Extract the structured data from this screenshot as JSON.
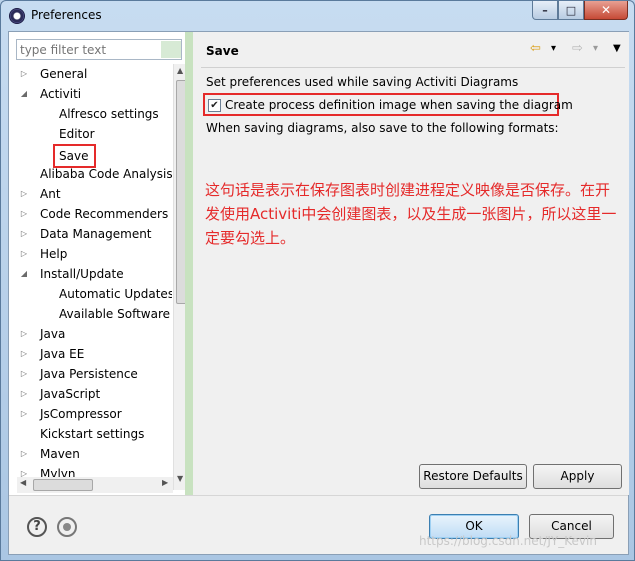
{
  "window": {
    "title": "Preferences",
    "min": "–",
    "max": "□",
    "close": "✕"
  },
  "filter": {
    "placeholder": "type filter text"
  },
  "tree": [
    {
      "label": "General",
      "level": 0,
      "twisty": "▷"
    },
    {
      "label": "Activiti",
      "level": 0,
      "twisty": "◢"
    },
    {
      "label": "Alfresco settings",
      "level": 1,
      "twisty": ""
    },
    {
      "label": "Editor",
      "level": 1,
      "twisty": ""
    },
    {
      "label": "Save",
      "level": 1,
      "twisty": "",
      "selected": true
    },
    {
      "label": "Alibaba Code Analysis",
      "level": 0,
      "twisty": ""
    },
    {
      "label": "Ant",
      "level": 0,
      "twisty": "▷"
    },
    {
      "label": "Code Recommenders",
      "level": 0,
      "twisty": "▷"
    },
    {
      "label": "Data Management",
      "level": 0,
      "twisty": "▷"
    },
    {
      "label": "Help",
      "level": 0,
      "twisty": "▷"
    },
    {
      "label": "Install/Update",
      "level": 0,
      "twisty": "◢"
    },
    {
      "label": "Automatic Updates",
      "level": 1,
      "twisty": ""
    },
    {
      "label": "Available Software",
      "level": 1,
      "twisty": ""
    },
    {
      "label": "Java",
      "level": 0,
      "twisty": "▷"
    },
    {
      "label": "Java EE",
      "level": 0,
      "twisty": "▷"
    },
    {
      "label": "Java Persistence",
      "level": 0,
      "twisty": "▷"
    },
    {
      "label": "JavaScript",
      "level": 0,
      "twisty": "▷"
    },
    {
      "label": "JsCompressor",
      "level": 0,
      "twisty": "▷"
    },
    {
      "label": "Kickstart settings",
      "level": 0,
      "twisty": ""
    },
    {
      "label": "Maven",
      "level": 0,
      "twisty": "▷"
    },
    {
      "label": "Mylyn",
      "level": 0,
      "twisty": "▷"
    }
  ],
  "page": {
    "title": "Save",
    "description": "Set preferences used while saving Activiti Diagrams",
    "checkbox_label": "Create process definition image when saving the diagram",
    "checkbox_checked": true,
    "checkbox_mark": "✔",
    "formats_label": "When saving diagrams, also save to the following formats:",
    "annotation": "这句话是表示在保存图表时创建进程定义映像是否保存。在开发使用Activiti中会创建图表，以及生成一张图片，所以这里一定要勾选上。",
    "nav_back": "⇦",
    "nav_forward": "⇨",
    "nav_dropdown": "▾",
    "nav_menu": "▼"
  },
  "buttons": {
    "restore_defaults": "Restore Defaults",
    "apply": "Apply",
    "ok": "OK",
    "cancel": "Cancel",
    "help": "?"
  },
  "watermark": "https://blog.csdn.net/JY_Kevin",
  "colors": {
    "highlight": "#e52a2a",
    "sash": "#c8e2c0"
  }
}
